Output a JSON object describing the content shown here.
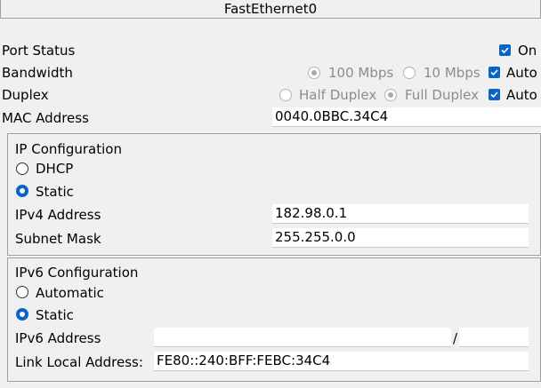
{
  "title": "FastEthernet0",
  "port_status": {
    "label": "Port Status",
    "option_label": "On",
    "checked": true
  },
  "bandwidth": {
    "label": "Bandwidth",
    "options": [
      "100 Mbps",
      "10 Mbps"
    ],
    "selected": "100 Mbps",
    "auto_label": "Auto",
    "auto_checked": true
  },
  "duplex": {
    "label": "Duplex",
    "options": [
      "Half Duplex",
      "Full Duplex"
    ],
    "selected": "Full Duplex",
    "auto_label": "Auto",
    "auto_checked": true
  },
  "mac": {
    "label": "MAC Address",
    "value": "0040.0BBC.34C4"
  },
  "ipv4": {
    "heading": "IP Configuration",
    "dhcp_label": "DHCP",
    "static_label": "Static",
    "selected": "Static",
    "address_label": "IPv4 Address",
    "address_value": "182.98.0.1",
    "mask_label": "Subnet Mask",
    "mask_value": "255.255.0.0"
  },
  "ipv6": {
    "heading": "IPv6 Configuration",
    "automatic_label": "Automatic",
    "static_label": "Static",
    "selected": "Static",
    "address_label": "IPv6 Address",
    "address_value": "",
    "separator": "/",
    "prefix_value": "",
    "link_local_label": "Link Local Address:",
    "link_local_value": "FE80::240:BFF:FEBC:34C4"
  },
  "colors": {
    "accent": "#0a64c8",
    "background": "#f0f0f0",
    "disabled_text": "#8c8c8c"
  }
}
